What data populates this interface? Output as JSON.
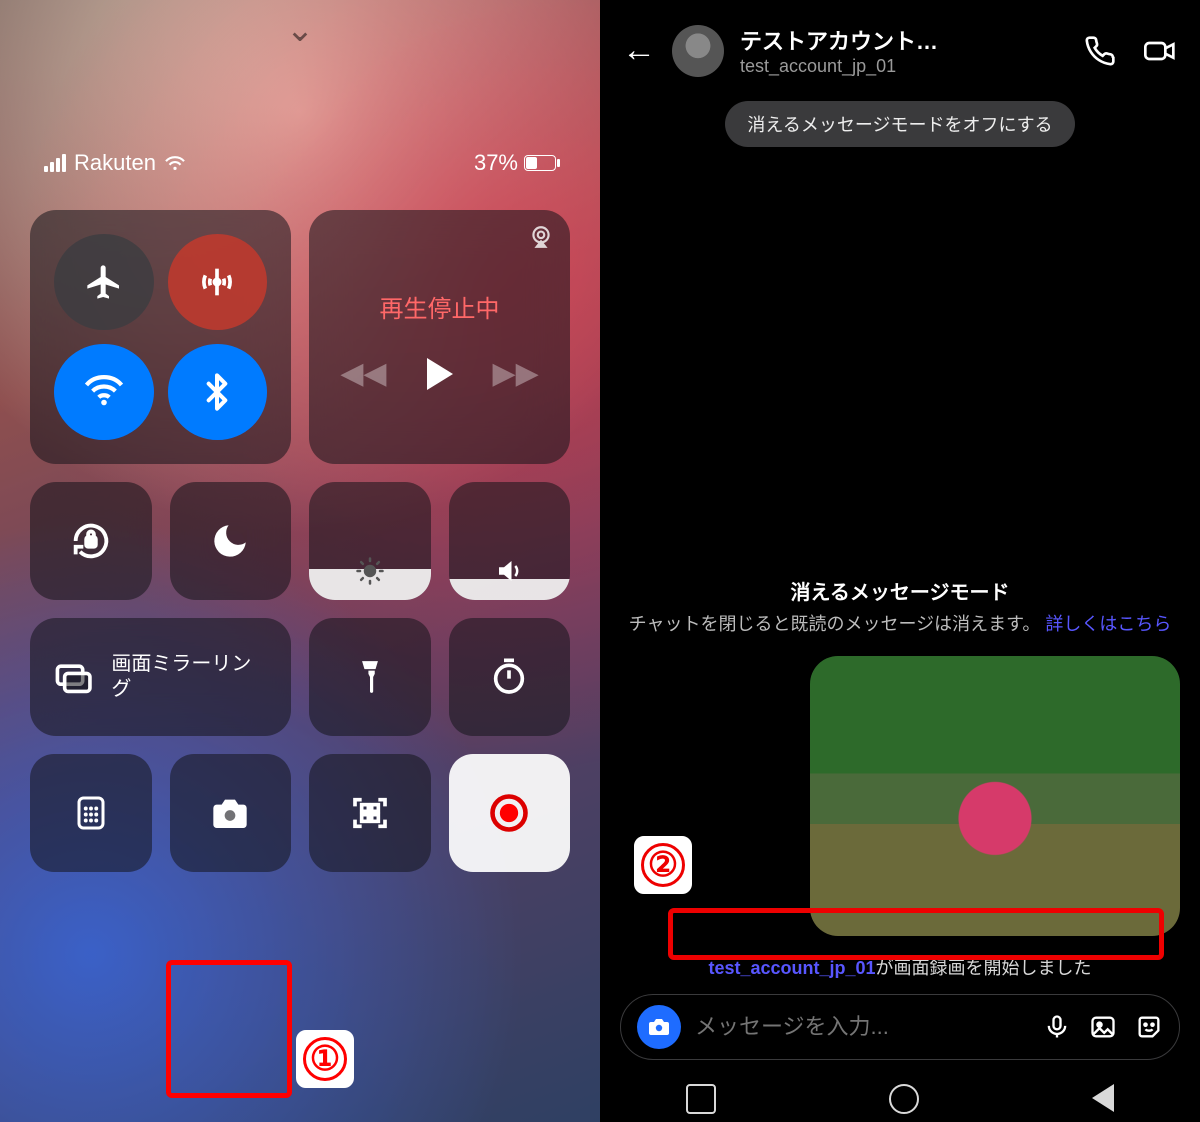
{
  "left": {
    "carrier": "Rakuten",
    "battery_pct": "37%",
    "media_status": "再生停止中",
    "mirror_label": "画面ミラーリング",
    "annot1": "①"
  },
  "right": {
    "header": {
      "display_name": "テストアカウント…",
      "username": "test_account_jp_01"
    },
    "pill": "消えるメッセージモードをオフにする",
    "vanish": {
      "title": "消えるメッセージモード",
      "desc_pre": "チャットを閉じると既読のメッセージは消えます。",
      "link": "詳しくはこちら"
    },
    "notice": {
      "user": "test_account_jp_01",
      "text": "が画面録画を開始しました"
    },
    "input_placeholder": "メッセージを入力...",
    "annot2": "②"
  }
}
